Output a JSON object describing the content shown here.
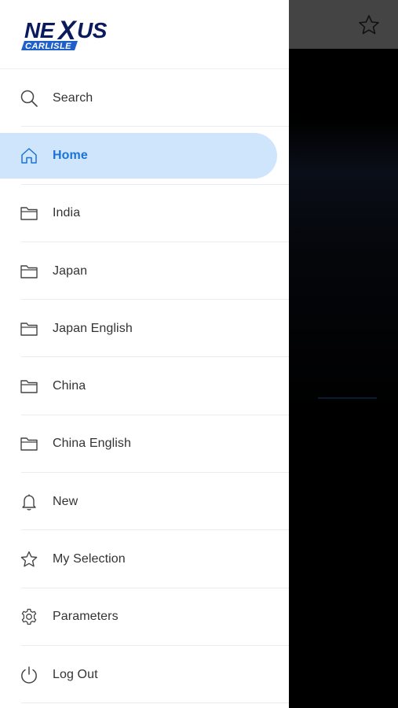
{
  "app": {
    "logo_main": "NEXUS",
    "logo_sub": "CARLISLE"
  },
  "menu": {
    "items": [
      {
        "label": "Search",
        "icon": "search-icon"
      },
      {
        "label": "Home",
        "icon": "home-icon",
        "active": true
      },
      {
        "label": "India",
        "icon": "folder-icon"
      },
      {
        "label": "Japan",
        "icon": "folder-icon"
      },
      {
        "label": "Japan English",
        "icon": "folder-icon"
      },
      {
        "label": "China",
        "icon": "folder-icon"
      },
      {
        "label": "China English",
        "icon": "folder-icon"
      },
      {
        "label": "New",
        "icon": "bell-icon"
      },
      {
        "label": "My Selection",
        "icon": "star-icon"
      },
      {
        "label": "Parameters",
        "icon": "gear-icon"
      },
      {
        "label": "Log Out",
        "icon": "power-icon"
      }
    ]
  },
  "colors": {
    "accent": "#1a73d9",
    "active_bg": "#cfe5fb",
    "logo_navy": "#0b1a5c",
    "logo_blue": "#1f5fc8"
  }
}
